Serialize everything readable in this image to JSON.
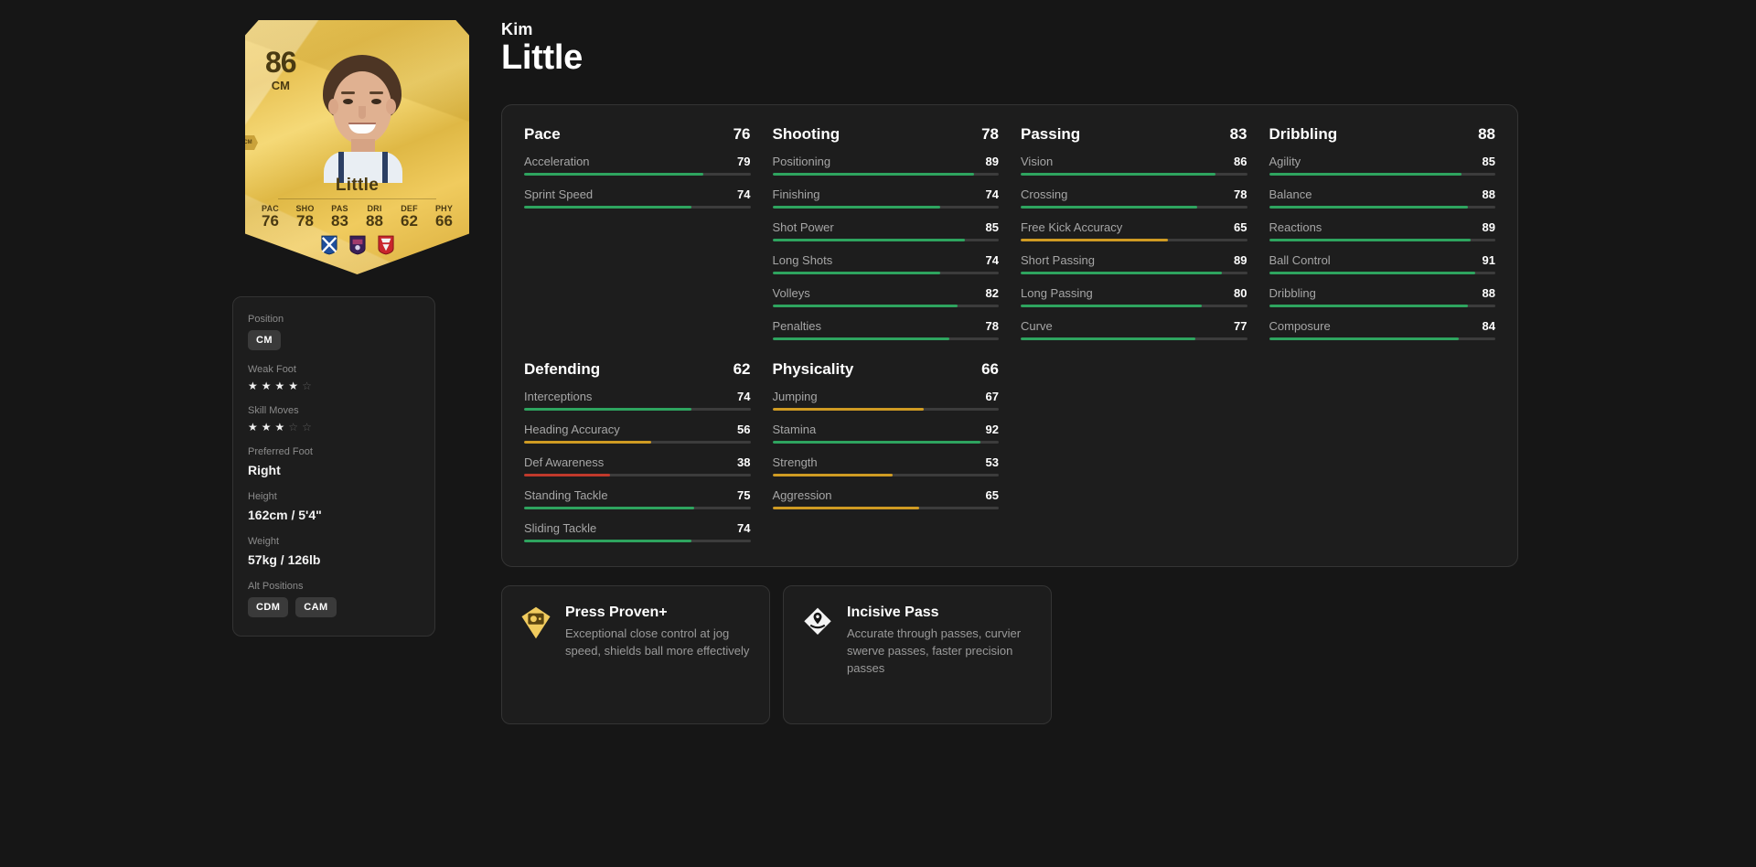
{
  "player": {
    "first_name": "Kim",
    "last_name": "Little",
    "card": {
      "rating": "86",
      "position": "CM",
      "chemistry_style": "CM",
      "surname": "Little",
      "stats": [
        {
          "key": "PAC",
          "value": "76"
        },
        {
          "key": "SHO",
          "value": "78"
        },
        {
          "key": "PAS",
          "value": "83"
        },
        {
          "key": "DRI",
          "value": "88"
        },
        {
          "key": "DEF",
          "value": "62"
        },
        {
          "key": "PHY",
          "value": "66"
        }
      ],
      "badges": [
        "scotland-flag-icon",
        "wsl-league-icon",
        "arsenal-club-icon"
      ]
    }
  },
  "info": {
    "position_label": "Position",
    "position_value": "CM",
    "weak_foot_label": "Weak Foot",
    "weak_foot": 4,
    "skill_moves_label": "Skill Moves",
    "skill_moves": 3,
    "star_max": 5,
    "preferred_foot_label": "Preferred Foot",
    "preferred_foot_value": "Right",
    "height_label": "Height",
    "height_value": "162cm / 5'4\"",
    "weight_label": "Weight",
    "weight_value": "57kg / 126lb",
    "alt_positions_label": "Alt Positions",
    "alt_positions": [
      "CDM",
      "CAM"
    ]
  },
  "colors": {
    "green": "#2ea45f",
    "orange": "#cf9b23",
    "red": "#c0392b",
    "track": "#3c3c3c",
    "panel": "#1d1d1d",
    "border": "#343434",
    "background": "#161616",
    "gold": "#f0cb5e"
  },
  "stat_groups": [
    {
      "name": "Pace",
      "value": 76,
      "stats": [
        {
          "name": "Acceleration",
          "value": 79
        },
        {
          "name": "Sprint Speed",
          "value": 74
        }
      ]
    },
    {
      "name": "Shooting",
      "value": 78,
      "stats": [
        {
          "name": "Positioning",
          "value": 89
        },
        {
          "name": "Finishing",
          "value": 74
        },
        {
          "name": "Shot Power",
          "value": 85
        },
        {
          "name": "Long Shots",
          "value": 74
        },
        {
          "name": "Volleys",
          "value": 82
        },
        {
          "name": "Penalties",
          "value": 78
        }
      ]
    },
    {
      "name": "Passing",
      "value": 83,
      "stats": [
        {
          "name": "Vision",
          "value": 86
        },
        {
          "name": "Crossing",
          "value": 78
        },
        {
          "name": "Free Kick Accuracy",
          "value": 65
        },
        {
          "name": "Short Passing",
          "value": 89
        },
        {
          "name": "Long Passing",
          "value": 80
        },
        {
          "name": "Curve",
          "value": 77
        }
      ]
    },
    {
      "name": "Dribbling",
      "value": 88,
      "stats": [
        {
          "name": "Agility",
          "value": 85
        },
        {
          "name": "Balance",
          "value": 88
        },
        {
          "name": "Reactions",
          "value": 89
        },
        {
          "name": "Ball Control",
          "value": 91
        },
        {
          "name": "Dribbling",
          "value": 88
        },
        {
          "name": "Composure",
          "value": 84
        }
      ]
    },
    {
      "name": "Defending",
      "value": 62,
      "stats": [
        {
          "name": "Interceptions",
          "value": 74
        },
        {
          "name": "Heading Accuracy",
          "value": 56
        },
        {
          "name": "Def Awareness",
          "value": 38
        },
        {
          "name": "Standing Tackle",
          "value": 75
        },
        {
          "name": "Sliding Tackle",
          "value": 74
        }
      ]
    },
    {
      "name": "Physicality",
      "value": 66,
      "stats": [
        {
          "name": "Jumping",
          "value": 67
        },
        {
          "name": "Stamina",
          "value": 92
        },
        {
          "name": "Strength",
          "value": 53
        },
        {
          "name": "Aggression",
          "value": 65
        }
      ]
    }
  ],
  "playstyles": [
    {
      "title": "Press Proven+",
      "description": "Exceptional close control at jog speed, shields ball more effectively",
      "icon": "press-proven-icon",
      "tier": "plus"
    },
    {
      "title": "Incisive Pass",
      "description": "Accurate through passes, curvier swerve passes, faster precision passes",
      "icon": "incisive-pass-icon",
      "tier": "standard"
    }
  ]
}
